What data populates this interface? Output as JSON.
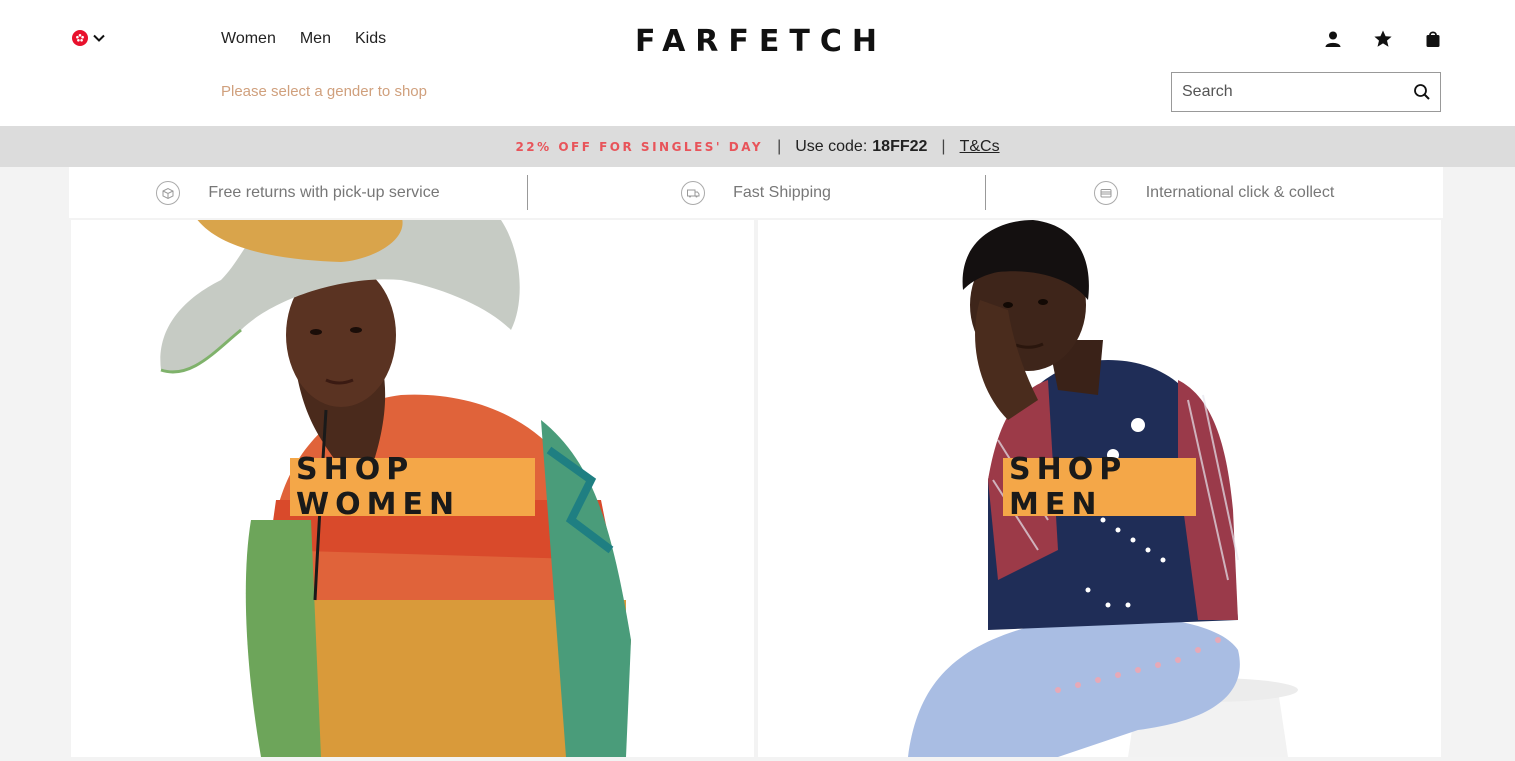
{
  "header": {
    "logo": "FARFETCH",
    "region_icon": "hong-kong-flag-icon",
    "gender_nav": [
      "Women",
      "Men",
      "Kids"
    ],
    "gender_hint": "Please select a gender to shop",
    "search_placeholder": "Search",
    "icons": [
      "account-icon",
      "wishlist-star-icon",
      "shopping-bag-icon"
    ]
  },
  "promo": {
    "deal": "22% OFF FOR SINGLES' DAY",
    "separator": "|",
    "code_label": "Use code:",
    "code": "18FF22",
    "terms": "T&Cs"
  },
  "usps": [
    {
      "label": "Free returns with pick-up service",
      "icon": "returns-box-icon"
    },
    {
      "label": "Fast Shipping",
      "icon": "shipping-truck-icon"
    },
    {
      "label": "International click & collect",
      "icon": "click-collect-icon"
    }
  ],
  "panels": {
    "women": {
      "cta": "SHOP WOMEN"
    },
    "men": {
      "cta": "SHOP MEN"
    }
  },
  "colors": {
    "promo_text": "#e8545a",
    "cta_background": "#f4a748",
    "gender_hint": "#d0a07d",
    "promo_bar": "#dcdcdc"
  }
}
